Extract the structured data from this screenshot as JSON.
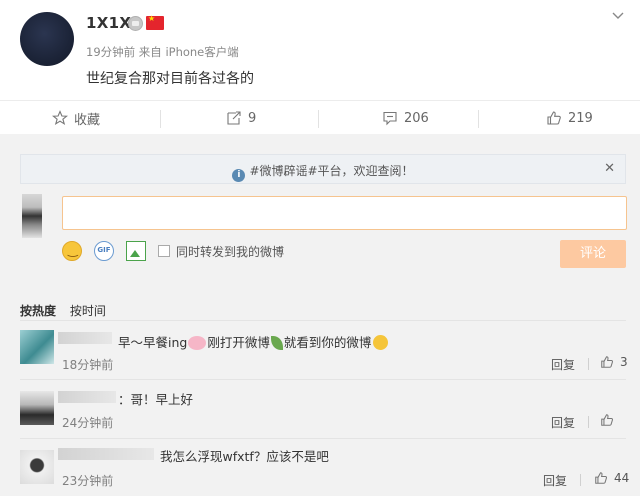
{
  "post": {
    "username": "1X1X",
    "meta": "19分钟前 来自 iPhone客户端",
    "text": "世纪复合那对目前各过各的"
  },
  "actions": {
    "favorite_label": "收藏",
    "forward_count": "9",
    "comment_count": "206",
    "like_count": "219"
  },
  "notice": {
    "text": "#微博辟谣#平台，欢迎查阅！"
  },
  "composer": {
    "sync_label": "同时转发到我的微博",
    "submit_label": "评论"
  },
  "sort": {
    "hot": "按热度",
    "time": "按时间"
  },
  "comments": [
    {
      "text_a": "早～早餐ing",
      "text_b": "刚打开微博",
      "text_c": "就看到你的微博",
      "time": "18分钟前",
      "reply": "回复",
      "likes": "3"
    },
    {
      "text": "：哥！早上好",
      "time": "24分钟前",
      "reply": "回复",
      "likes": ""
    },
    {
      "text": "我怎么浮现wfxtf？应该不是吧",
      "time": "23分钟前",
      "reply": "回复",
      "likes": "44"
    }
  ]
}
